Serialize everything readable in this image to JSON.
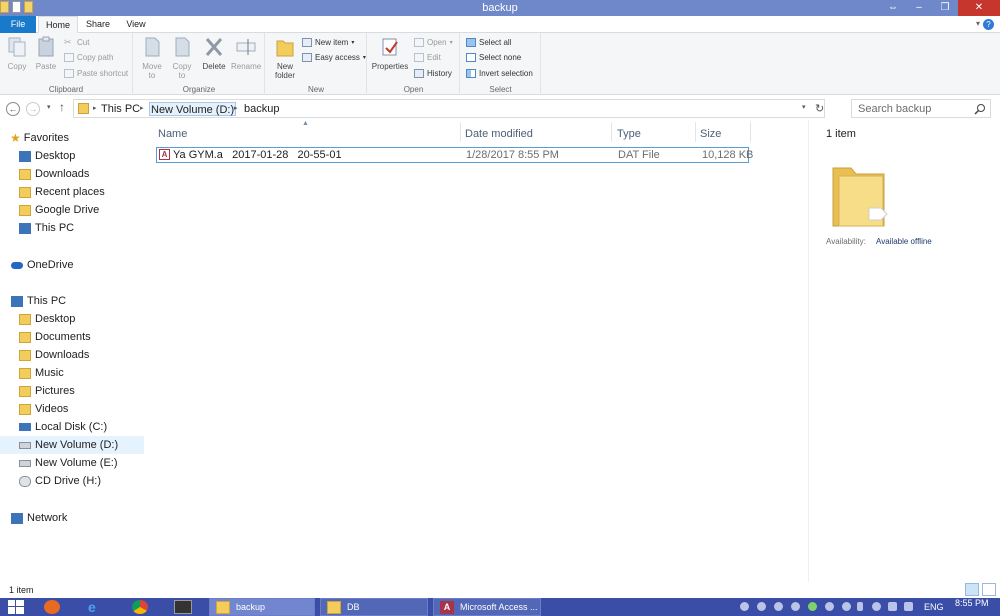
{
  "window": {
    "title": "backup",
    "controls": [
      "⇔",
      "–",
      "❐",
      "✕"
    ]
  },
  "tabs": {
    "file": "File",
    "home": "Home",
    "share": "Share",
    "view": "View"
  },
  "ribbon": {
    "clipboard": {
      "label": "Clipboard",
      "copy": "Copy",
      "paste": "Paste",
      "cut": "Cut",
      "copy_path": "Copy path",
      "paste_shortcut": "Paste shortcut"
    },
    "organize": {
      "label": "Organize",
      "move_to": "Move to",
      "copy_to": "Copy to",
      "delete": "Delete",
      "rename": "Rename"
    },
    "new": {
      "label": "New",
      "new_folder": "New folder",
      "new_item": "New item",
      "easy_access": "Easy access"
    },
    "open": {
      "label": "Open",
      "properties": "Properties",
      "open": "Open",
      "edit": "Edit",
      "history": "History"
    },
    "select": {
      "label": "Select",
      "select_all": "Select all",
      "select_none": "Select none",
      "invert_selection": "Invert selection"
    }
  },
  "address": {
    "crumbs": [
      "This PC",
      "New Volume (D:)",
      "backup"
    ],
    "search_placeholder": "Search backup"
  },
  "nav": {
    "favorites": "Favorites",
    "fav_items": [
      "Desktop",
      "Downloads",
      "Recent places",
      "Google Drive",
      "This PC"
    ],
    "onedrive": "OneDrive",
    "thispc": "This PC",
    "pc_items": [
      "Desktop",
      "Documents",
      "Downloads",
      "Music",
      "Pictures",
      "Videos",
      "Local Disk (C:)",
      "New Volume (D:)",
      "New Volume (E:)",
      "CD Drive (H:)"
    ],
    "network": "Network"
  },
  "columns": {
    "name": "Name",
    "date": "Date modified",
    "type": "Type",
    "size": "Size"
  },
  "files": [
    {
      "name": "Ya GYM.a   2017-01-28   20-55-01",
      "date": "1/28/2017 8:55 PM",
      "type": "DAT File",
      "size": "10,128 KB"
    }
  ],
  "preview": {
    "count": "1 item",
    "availability_label": "Availability:",
    "availability_value": "Available offline"
  },
  "status": {
    "count": "1 item"
  },
  "taskbar": {
    "tasks": [
      {
        "label": "backup"
      },
      {
        "label": "DB"
      },
      {
        "label": "Microsoft Access ..."
      }
    ],
    "lang": "ENG",
    "time": "8:55 PM"
  },
  "colors": {
    "accent": "#1979ca",
    "title_bar": "#6f88c9",
    "taskbar": "#3a4ea8",
    "selection": "#e5f3ff"
  }
}
